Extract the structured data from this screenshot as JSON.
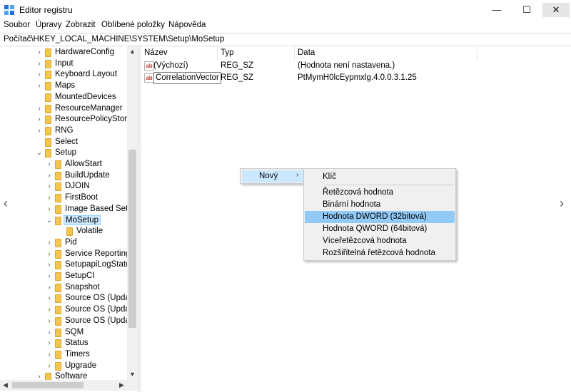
{
  "window": {
    "title": "Editor registru",
    "icons": {
      "app": "registry-icon",
      "minimize": "minimize-icon",
      "maximize": "maximize-icon",
      "close": "close-icon"
    }
  },
  "menu": [
    "Soubor",
    "Úpravy",
    "Zobrazit",
    "Oblíbené položky",
    "Nápověda"
  ],
  "address": "Počítač\\HKEY_LOCAL_MACHINE\\SYSTEM\\Setup\\MoSetup",
  "tree": [
    {
      "label": "HardwareConfig",
      "chev": "›"
    },
    {
      "label": "Input",
      "chev": "›"
    },
    {
      "label": "Keyboard Layout",
      "chev": "›"
    },
    {
      "label": "Maps",
      "chev": "›"
    },
    {
      "label": "MountedDevices",
      "chev": ""
    },
    {
      "label": "ResourceManager",
      "chev": "›"
    },
    {
      "label": "ResourcePolicyStore",
      "chev": "›"
    },
    {
      "label": "RNG",
      "chev": "›"
    },
    {
      "label": "Select",
      "chev": ""
    },
    {
      "label": "Setup",
      "chev": "⌄"
    },
    {
      "label": "AllowStart",
      "chev": "›"
    },
    {
      "label": "BuildUpdate",
      "chev": "›"
    },
    {
      "label": "DJOIN",
      "chev": "›"
    },
    {
      "label": "FirstBoot",
      "chev": "›"
    },
    {
      "label": "Image Based Setu",
      "chev": "›"
    },
    {
      "label": "MoSetup",
      "chev": "⌄",
      "selected": true
    },
    {
      "label": "Volatile",
      "chev": ""
    },
    {
      "label": "Pid",
      "chev": "›"
    },
    {
      "label": "Service Reporting",
      "chev": "›"
    },
    {
      "label": "SetupapiLogStatu",
      "chev": "›"
    },
    {
      "label": "SetupCI",
      "chev": "›"
    },
    {
      "label": "Snapshot",
      "chev": "›"
    },
    {
      "label": "Source OS (Updat",
      "chev": "›"
    },
    {
      "label": "Source OS (Updat",
      "chev": "›"
    },
    {
      "label": "Source OS (Updat",
      "chev": "›"
    },
    {
      "label": "SQM",
      "chev": "›"
    },
    {
      "label": "Status",
      "chev": "›"
    },
    {
      "label": "Timers",
      "chev": "›"
    },
    {
      "label": "Upgrade",
      "chev": "›"
    },
    {
      "label": "Software",
      "chev": "›"
    }
  ],
  "columns": [
    "Název",
    "Typ",
    "Data"
  ],
  "values": [
    {
      "name": "(Výchozí)",
      "type": "REG_SZ",
      "data": "(Hodnota není nastavena.)",
      "editing": false
    },
    {
      "name": "CorrelationVector",
      "type": "REG_SZ",
      "data": "PtMymH0lcEypmxlg.4.0.0.3.1.25",
      "editing": true
    }
  ],
  "context_menu": {
    "parent": "Nový",
    "items": [
      "Klíč",
      "Řetězcová hodnota",
      "Binární hodnota",
      "Hodnota DWORD (32bitová)",
      "Hodnota QWORD (64bitová)",
      "Víceřetězcová hodnota",
      "Rozšiřitelná řetězcová hodnota"
    ],
    "highlighted": "Hodnota DWORD (32bitová)"
  },
  "colors": {
    "selection": "#cce8ff",
    "menu_hover": "#91c9f7",
    "folder": "#f3c74f"
  }
}
